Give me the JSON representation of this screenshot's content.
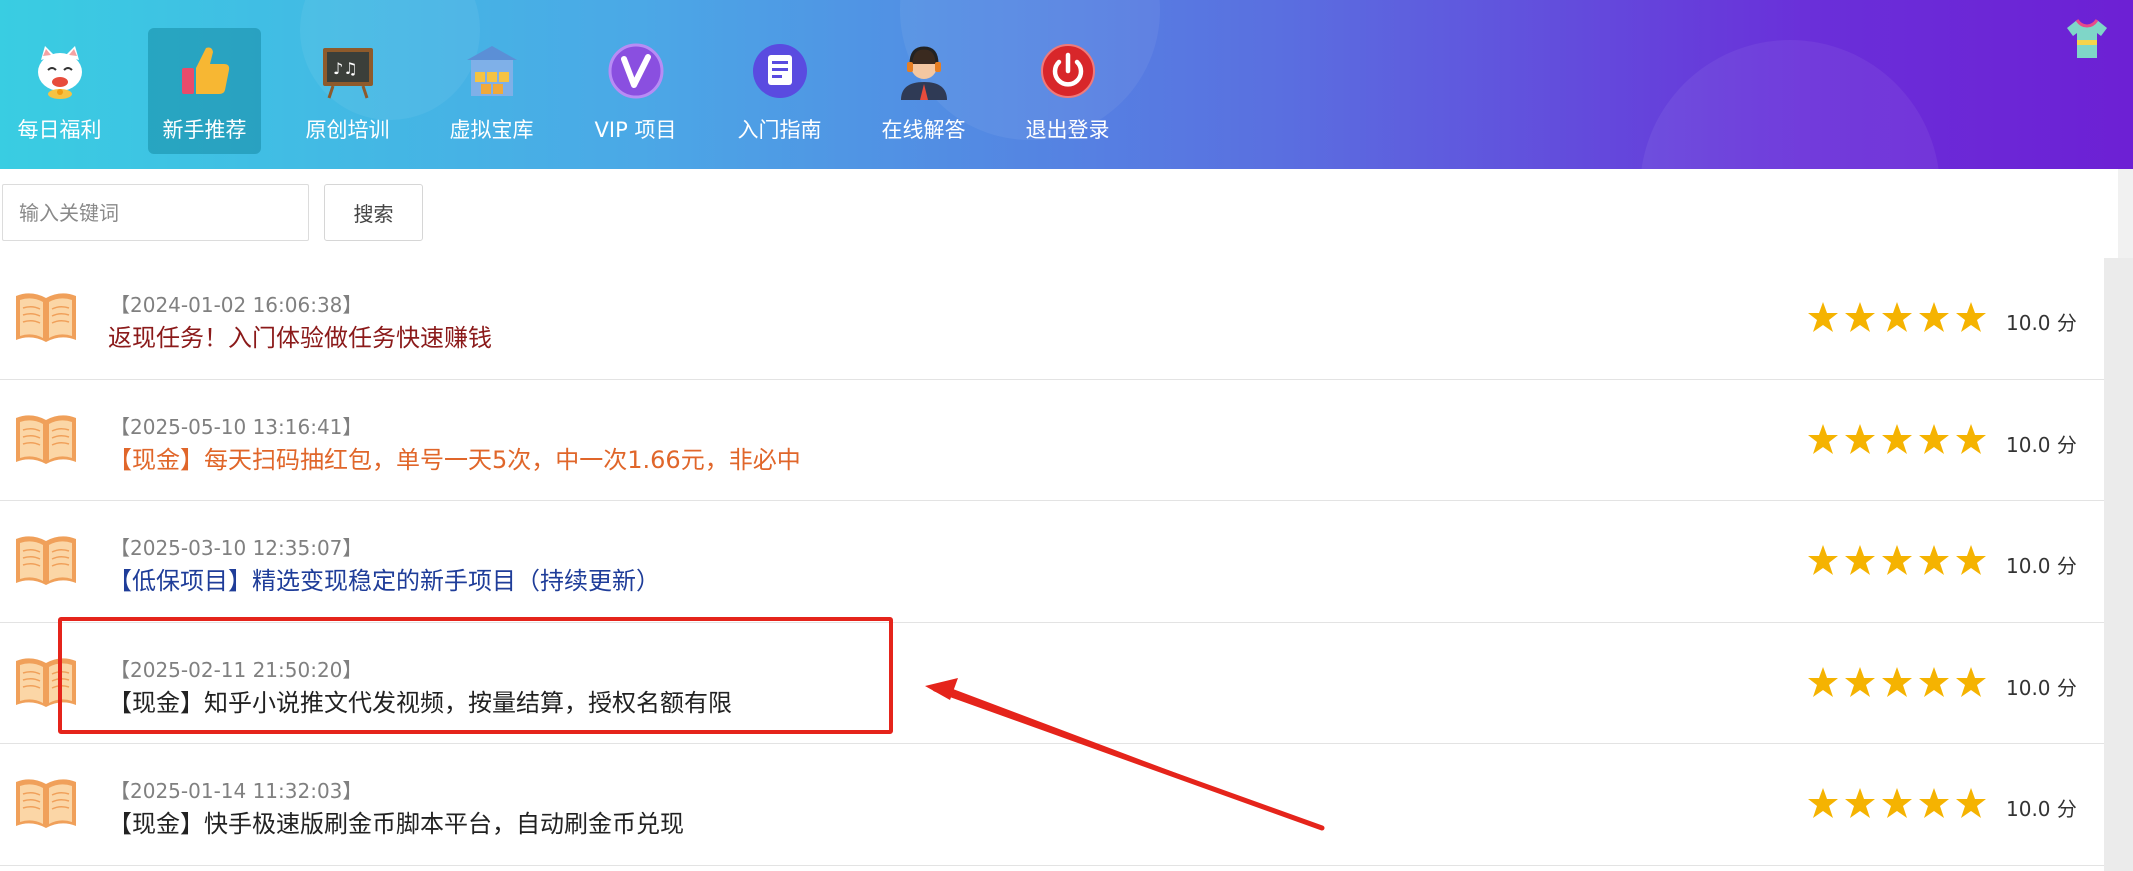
{
  "nav": {
    "items": [
      {
        "label": "每日福利",
        "icon": "lucky-cat-icon",
        "active": false
      },
      {
        "label": "新手推荐",
        "icon": "thumbs-up-icon",
        "active": true
      },
      {
        "label": "原创培训",
        "icon": "blackboard-icon",
        "active": false
      },
      {
        "label": "虚拟宝库",
        "icon": "warehouse-icon",
        "active": false
      },
      {
        "label": "VIP 项目",
        "icon": "vip-icon",
        "active": false
      },
      {
        "label": "入门指南",
        "icon": "document-icon",
        "active": false
      },
      {
        "label": "在线解答",
        "icon": "support-agent-icon",
        "active": false
      },
      {
        "label": "退出登录",
        "icon": "power-icon",
        "active": false
      }
    ],
    "right_icon": "shirt-icon"
  },
  "search": {
    "placeholder": "输入关键词",
    "button_label": "搜索"
  },
  "list": {
    "items": [
      {
        "date": "【2024-01-02 16:06:38】",
        "title": "返现任务！入门体验做任务快速赚钱",
        "title_color": "#8b1a1a",
        "rating": 5,
        "score": "10.0 分"
      },
      {
        "date": "【2025-05-10 13:16:41】",
        "title": "【现金】每天扫码抽红包，单号一天5次，中一次1.66元，非必中",
        "title_color": "#e0662a",
        "rating": 5,
        "score": "10.0 分"
      },
      {
        "date": "【2025-03-10 12:35:07】",
        "title": "【低保项目】精选变现稳定的新手项目（持续更新）",
        "title_color": "#1f3d99",
        "rating": 5,
        "score": "10.0 分"
      },
      {
        "date": "【2025-02-11 21:50:20】",
        "title": "【现金】知乎小说推文代发视频，按量结算，授权名额有限",
        "title_color": "#222222",
        "rating": 5,
        "score": "10.0 分"
      },
      {
        "date": "【2025-01-14 11:32:03】",
        "title": "【现金】快手极速版刷金币脚本平台，自动刷金币兑现",
        "title_color": "#222222",
        "rating": 5,
        "score": "10.0 分"
      }
    ]
  },
  "colors": {
    "star": "#f5b301",
    "book": "#f0a05a",
    "annotation": "#e5241b",
    "active_nav": "#1e8fa5"
  }
}
